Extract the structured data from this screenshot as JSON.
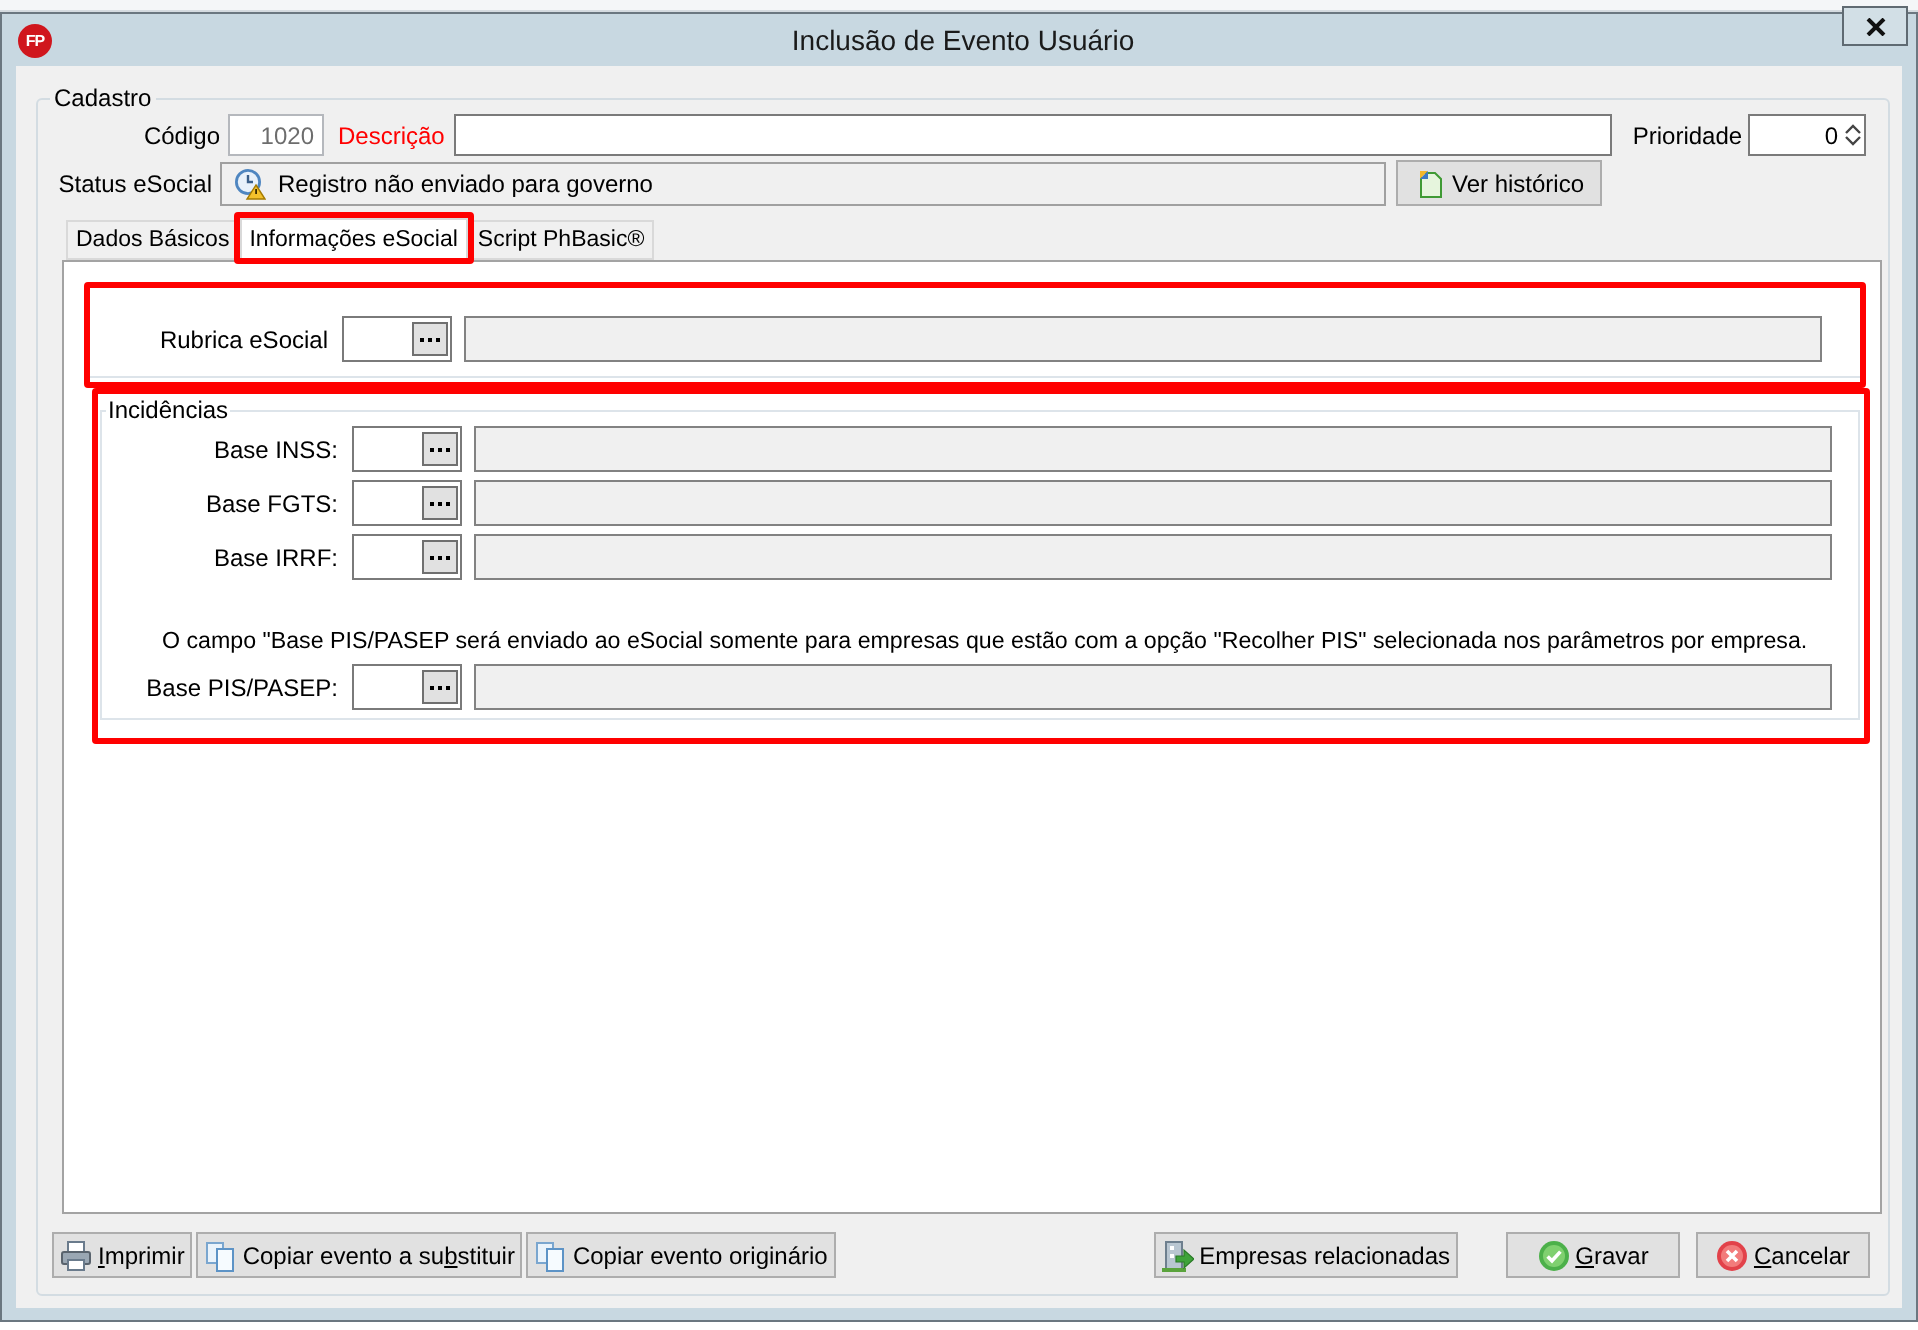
{
  "window": {
    "title": "Inclusão de Evento Usuário",
    "logo": "FP"
  },
  "cadastro": {
    "legend": "Cadastro",
    "codigo": {
      "label": "Código",
      "value": "1020",
      "disabled": true
    },
    "descricao": {
      "label": "Descrição",
      "required": true
    },
    "prioridade": {
      "label": "Prioridade",
      "value": "0"
    },
    "status": {
      "label": "Status eSocial",
      "value": "Registro não enviado para governo",
      "history_button": "Ver histórico"
    }
  },
  "tabs": [
    {
      "label": "Dados Básicos",
      "selected": false,
      "highlighted": false
    },
    {
      "label": "Informações eSocial",
      "selected": true,
      "highlighted": true
    },
    {
      "label": "Script PhBasic®",
      "selected": false,
      "highlighted": false
    }
  ],
  "esocial": {
    "rubrica": {
      "label": "Rubrica eSocial",
      "highlighted": true
    },
    "incidencias": {
      "legend": "Incidências",
      "highlighted": true,
      "fields": [
        {
          "label": "Base INSS:"
        },
        {
          "label": "Base FGTS:"
        },
        {
          "label": "Base IRRF:"
        }
      ],
      "note": "O campo \"Base PIS/PASEP será enviado ao eSocial somente para empresas que estão com a opção \"Recolher PIS\" selecionada nos parâmetros por empresa.",
      "pis_field": {
        "label": "Base PIS/PASEP:"
      }
    }
  },
  "buttons_left": [
    {
      "kind": "print",
      "access_key": "I",
      "label_rest": "mprimir"
    },
    {
      "kind": "copy",
      "label": "Copiar evento a su",
      "access_key": "b",
      "label_rest": "stituir"
    },
    {
      "kind": "copy",
      "label": "Copiar evento originário"
    }
  ],
  "buttons_right": [
    {
      "kind": "companies",
      "label": "Empresas relacionadas"
    },
    {
      "kind": "save",
      "access_key": "G",
      "label_rest": "ravar"
    },
    {
      "kind": "cancel",
      "access_key": "C",
      "label_rest": "ancelar"
    }
  ]
}
